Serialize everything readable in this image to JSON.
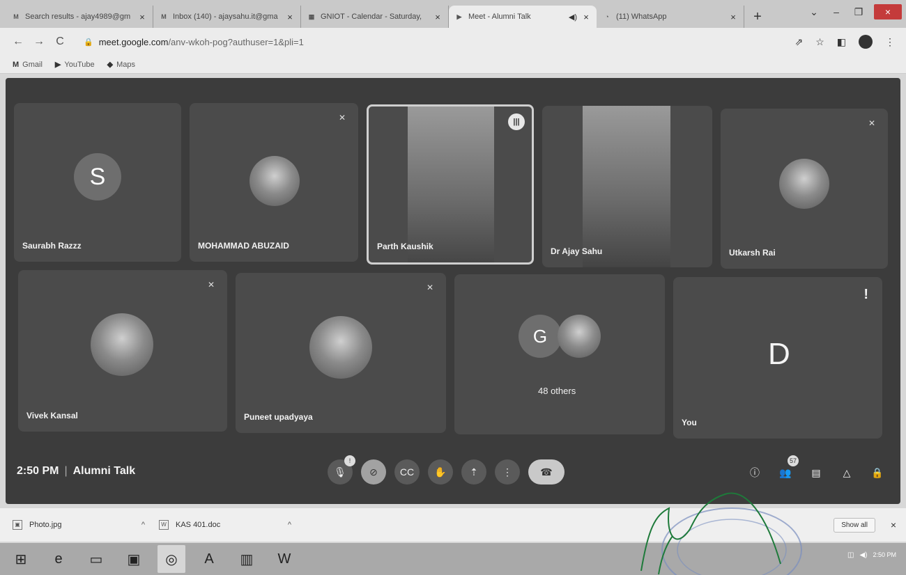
{
  "browser": {
    "tabs": [
      {
        "label": "Search results - ajay4989@gm",
        "icon": "gmail-icon",
        "active": false
      },
      {
        "label": "Inbox (140) - ajaysahu.it@gma",
        "icon": "gmail-icon",
        "active": false
      },
      {
        "label": "GNIOT - Calendar - Saturday,",
        "icon": "calendar-icon",
        "active": false
      },
      {
        "label": "Meet - Alumni Talk",
        "icon": "meet-icon",
        "active": true
      },
      {
        "label": "(11) WhatsApp",
        "icon": "whatsapp-icon",
        "active": false
      }
    ],
    "url_host": "meet.google.com",
    "url_path": "/anv-wkoh-pog?authuser=1&pli=1",
    "bookmarks": [
      {
        "label": "Gmail",
        "icon": "gmail-icon"
      },
      {
        "label": "YouTube",
        "icon": "youtube-icon"
      },
      {
        "label": "Maps",
        "icon": "maps-icon"
      }
    ]
  },
  "meet": {
    "participants": [
      {
        "name": "Saurabh Razzz",
        "avatar_letter": "S",
        "muted": false
      },
      {
        "name": "MOHAMMAD ABUZAID",
        "avatar_letter": "",
        "muted": true
      },
      {
        "name": "Parth Kaushik",
        "avatar_letter": "",
        "muted": false
      },
      {
        "name": "Dr Ajay Sahu",
        "avatar_letter": "",
        "muted": false
      },
      {
        "name": "Utkarsh Rai",
        "avatar_letter": "",
        "muted": true
      },
      {
        "name": "Vivek Kansal",
        "avatar_letter": "",
        "muted": true
      },
      {
        "name": "Puneet upadyaya",
        "avatar_letter": "",
        "muted": true
      },
      {
        "name": "48 others",
        "avatar_letter": "G",
        "muted": false
      },
      {
        "name": "You",
        "avatar_letter": "D",
        "muted": false
      }
    ],
    "time": "2:50 PM",
    "meeting_title": "Alumni Talk",
    "participant_count": "57",
    "mic_badge": "!"
  },
  "downloads": [
    {
      "label": "Photo.jpg"
    },
    {
      "label": "KAS 401.doc"
    }
  ],
  "show_all_label": "Show all",
  "taskbar": {
    "clock": "2:50 PM"
  }
}
